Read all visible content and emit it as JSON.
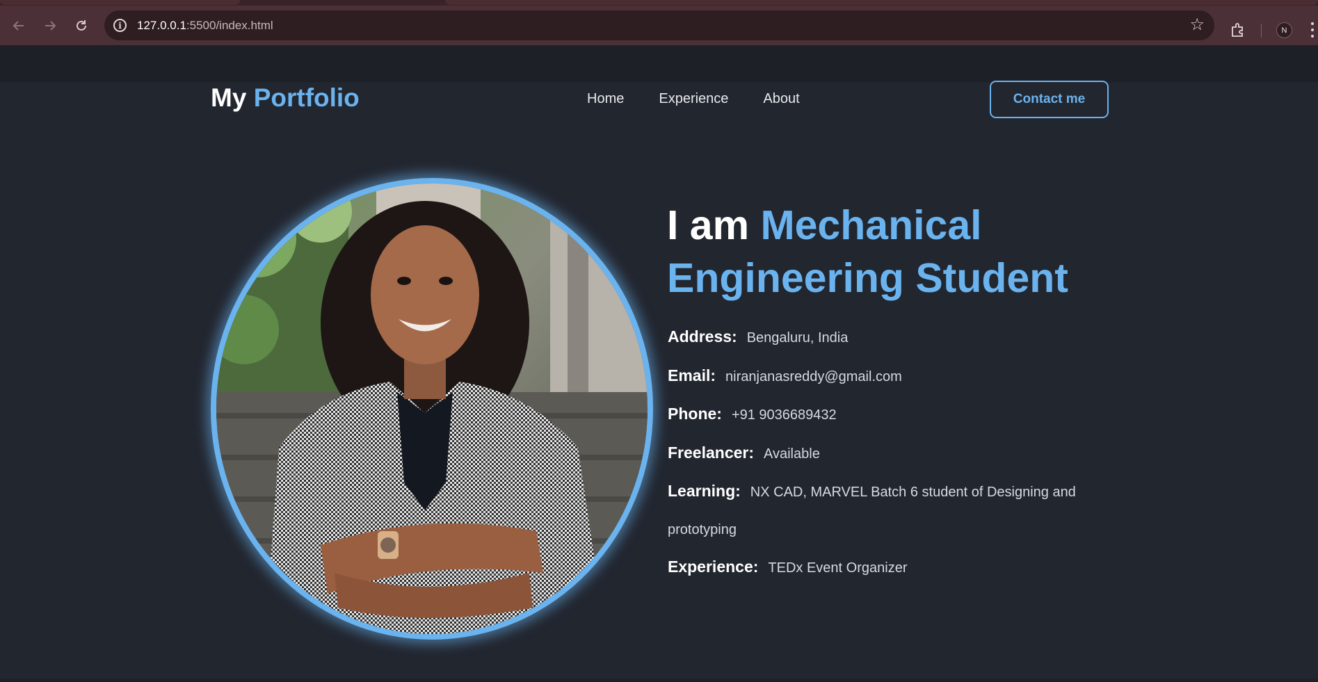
{
  "browser": {
    "url_host": "127.0.0.1",
    "url_path": ":5500/index.html",
    "profile_initial": "N"
  },
  "header": {
    "brand_prefix": "My",
    "brand_accent": "Portfolio",
    "nav": [
      "Home",
      "Experience",
      "About"
    ],
    "contact_label": "Contact me"
  },
  "hero": {
    "title_prefix": "I am",
    "title_accent": "Mechanical Engineering Student",
    "portrait_icon": "person-photo",
    "info": [
      {
        "key": "Address:",
        "value": "Bengaluru, India"
      },
      {
        "key": "Email:",
        "value": "niranjanasreddy@gmail.com"
      },
      {
        "key": "Phone:",
        "value": "+91 9036689432"
      },
      {
        "key": "Freelancer:",
        "value": "Available"
      },
      {
        "key": "Learning:",
        "value": "NX CAD, MARVEL Batch 6 student of Designing and prototyping"
      },
      {
        "key": "Experience:",
        "value": "TEDx Event Organizer"
      }
    ]
  },
  "colors": {
    "accent": "#6ab3ef",
    "page_bg": "#22262f",
    "chrome_bg": "#4b3137"
  }
}
